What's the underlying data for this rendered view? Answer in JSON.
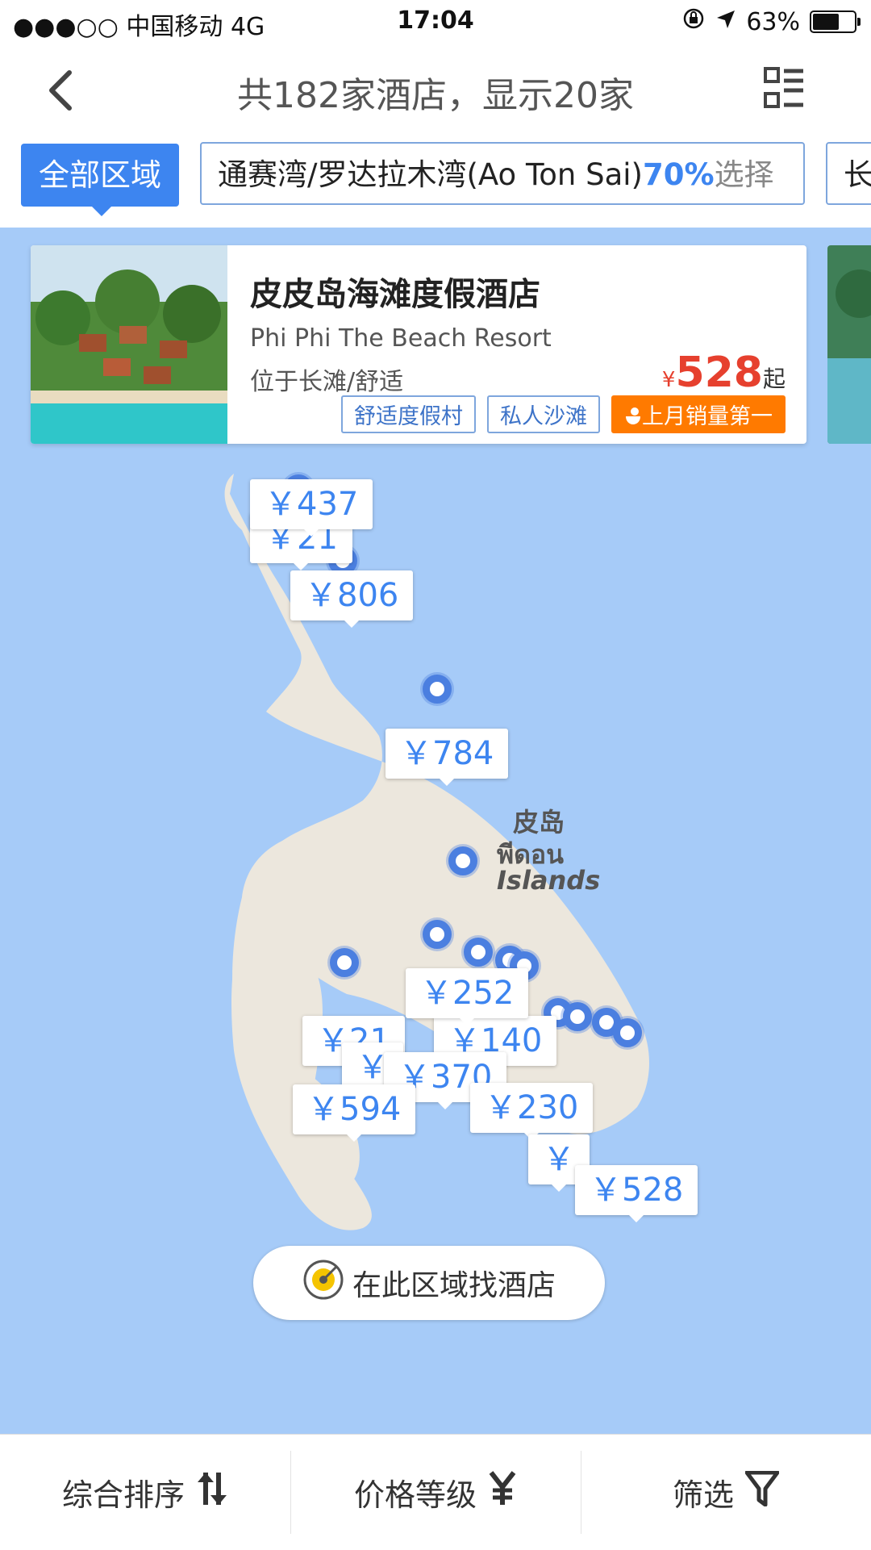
{
  "status_bar": {
    "carrier": "●●●○○ 中国移动  4G",
    "time": "17:04",
    "battery": "63%"
  },
  "nav": {
    "title": "共182家酒店，显示20家"
  },
  "filters": {
    "all_area": "全部区域",
    "area_name": "通赛湾/罗达拉木湾(Ao Ton Sai)",
    "area_percent": "70%",
    "area_select": "选择",
    "next_chip": "长"
  },
  "hotel_card": {
    "name_cn": "皮皮岛海滩度假酒店",
    "name_en": "Phi Phi The Beach Resort",
    "location": "位于长滩/舒适",
    "currency": "¥",
    "price": "528",
    "price_suffix": "起",
    "tags": [
      "舒适度假村",
      "私人沙滩"
    ],
    "hot_tag": "上月销量第一"
  },
  "map": {
    "bubbles": [
      "￥437",
      "￥806",
      "￥784",
      "￥252",
      "￥140",
      "￥370",
      "￥594",
      "￥230",
      "￥528",
      "￥21",
      "￥",
      "￥"
    ],
    "label_cn": "皮岛",
    "label_th": "พีดอน",
    "label_en": "Islands",
    "find_button": "在此区域找酒店"
  },
  "bottom_bar": {
    "sort": "综合排序",
    "price_level": "价格等级",
    "filter": "筛选"
  },
  "colors": {
    "accent": "#3d85f0",
    "price": "#e6402e",
    "map_water": "#a6cbf8",
    "map_land": "#ece7dd",
    "hot_tag": "#ff7a00"
  }
}
